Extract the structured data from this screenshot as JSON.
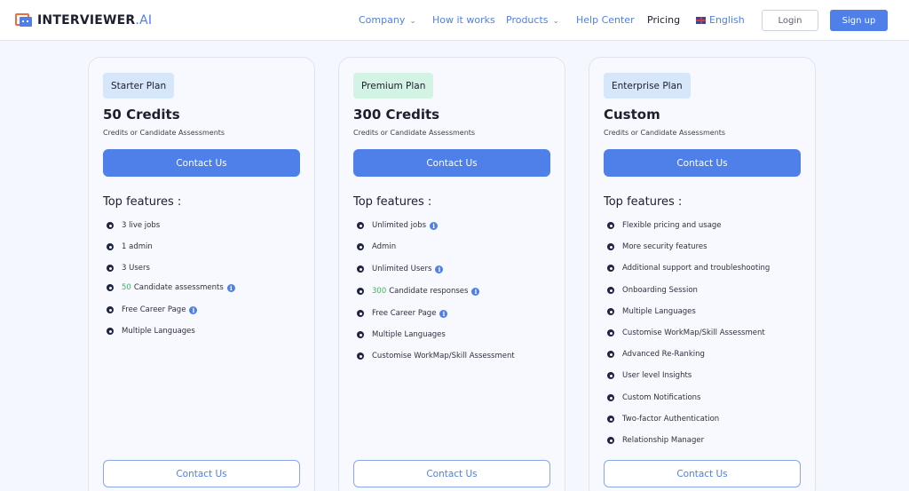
{
  "brand": {
    "name": "INTERVIEWER",
    "suffix": ".AI"
  },
  "nav": {
    "company": "Company",
    "how": "How it works",
    "products": "Products",
    "help": "Help Center",
    "pricing": "Pricing",
    "language": "English",
    "login": "Login",
    "signup": "Sign up"
  },
  "colors": {
    "accent": "#4f7fe8",
    "green": "#3cb55a",
    "badge_blue": "#d6e6fb",
    "badge_green": "#d3f3e4"
  },
  "plans": [
    {
      "badge": "Starter Plan",
      "credits": "50 Credits",
      "subtitle": "Credits or Candidate Assessments",
      "cta": "Contact Us",
      "features_title": "Top features :",
      "features": [
        "3 live jobs",
        "1 admin",
        "3 Users",
        "Candidate assessments",
        "Free Career Page",
        "Multiple Languages"
      ],
      "highlight_num": "50",
      "bottom_cta": "Contact Us"
    },
    {
      "badge": "Premium Plan",
      "credits": "300 Credits",
      "subtitle": "Credits or Candidate Assessments",
      "cta": "Contact Us",
      "features_title": "Top features :",
      "features": [
        "Unlimited jobs",
        "Admin",
        "Unlimited Users",
        "Candidate responses",
        "Free Career Page",
        "Multiple Languages",
        "Customise WorkMap/Skill Assessment"
      ],
      "highlight_num": "300",
      "bottom_cta": "Contact Us"
    },
    {
      "badge": "Enterprise Plan",
      "credits": "Custom",
      "subtitle": "Credits or Candidate Assessments",
      "cta": "Contact Us",
      "features_title": "Top features :",
      "features": [
        "Flexible pricing and usage",
        "More security features",
        "Additional support and troubleshooting",
        "Onboarding Session",
        "Multiple Languages",
        "Customise WorkMap/Skill Assessment",
        "Advanced Re-Ranking",
        "User level Insights",
        "Custom Notifications",
        "Two-factor Authentication",
        "Relationship Manager"
      ],
      "bottom_cta": "Contact Us"
    }
  ]
}
